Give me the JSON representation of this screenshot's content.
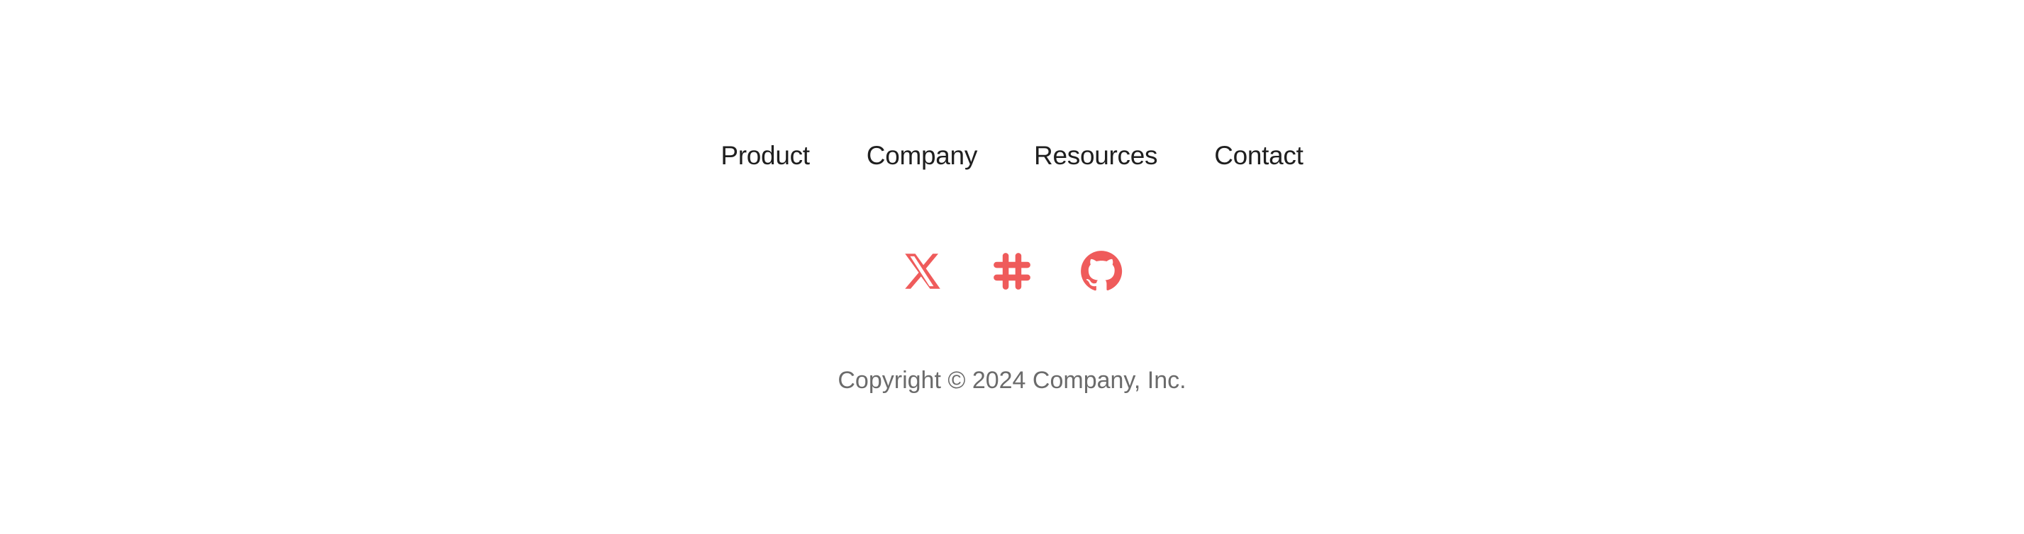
{
  "footer": {
    "nav": [
      {
        "label": "Product"
      },
      {
        "label": "Company"
      },
      {
        "label": "Resources"
      },
      {
        "label": "Contact"
      }
    ],
    "social": [
      {
        "icon": "x-twitter-icon"
      },
      {
        "icon": "slack-icon"
      },
      {
        "icon": "github-icon"
      }
    ],
    "accent_color": "#ef5b5b",
    "copyright": "Copyright © 2024 Company, Inc."
  }
}
